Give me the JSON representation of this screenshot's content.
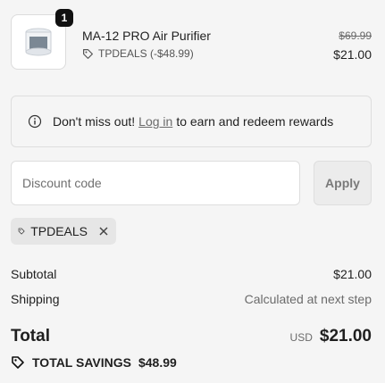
{
  "line_item": {
    "quantity": "1",
    "name": "MA-12 PRO Air Purifier",
    "discount_text": "TPDEALS (-$48.99)",
    "original_price": "$69.99",
    "price": "$21.00"
  },
  "notice": {
    "prefix": "Don't miss out!",
    "link": "Log in",
    "suffix": "to earn and redeem rewards"
  },
  "discount": {
    "placeholder": "Discount code",
    "apply_label": "Apply",
    "applied_code": "TPDEALS"
  },
  "summary": {
    "subtotal_label": "Subtotal",
    "subtotal_value": "$21.00",
    "shipping_label": "Shipping",
    "shipping_value": "Calculated at next step",
    "total_label": "Total",
    "currency": "USD",
    "total_value": "$21.00",
    "savings_label": "TOTAL SAVINGS",
    "savings_value": "$48.99"
  },
  "icons": {
    "product": "air-purifier-image",
    "tag": "tag-icon",
    "info": "info-icon",
    "remove": "close-icon"
  }
}
